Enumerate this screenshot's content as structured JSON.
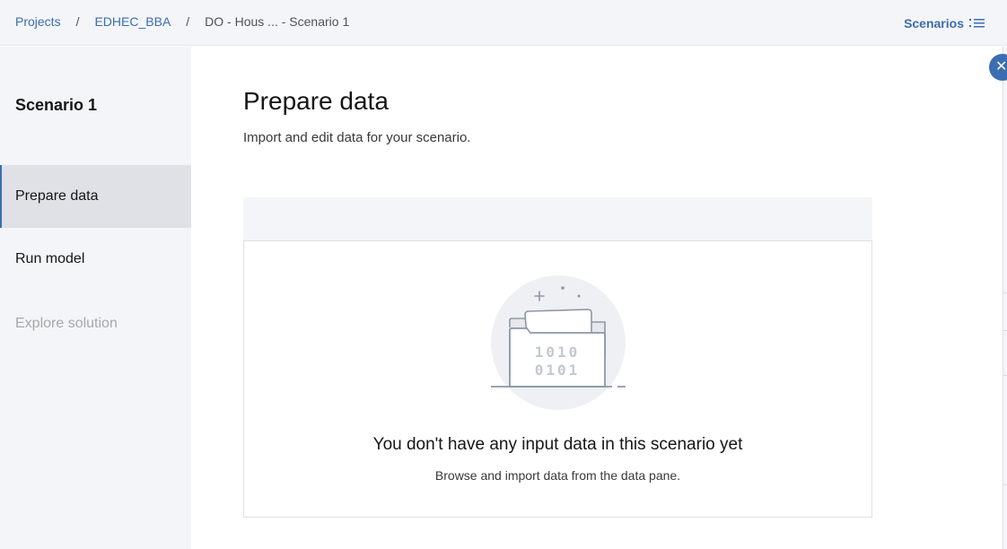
{
  "breadcrumb": {
    "items": [
      "Projects",
      "EDHEC_BBA"
    ],
    "separator": "/",
    "current": "DO - Hous ... - Scenario 1"
  },
  "header": {
    "scenarios_label": "Scenarios",
    "scenarios_icon": "list-icon"
  },
  "sidebar": {
    "title": "Scenario 1",
    "items": [
      {
        "label": "Prepare data",
        "state": "active"
      },
      {
        "label": "Run model",
        "state": "enabled"
      },
      {
        "label": "Explore solution",
        "state": "disabled"
      }
    ]
  },
  "main": {
    "title": "Prepare data",
    "subtitle": "Import and edit data for your scenario."
  },
  "empty_state": {
    "illustration_icon": "folder-binary-icon",
    "illustration_text": [
      "1010",
      "0101"
    ],
    "title": "You don't have any input data in this scenario yet",
    "subtitle": "Browse and import data from the data pane."
  },
  "close_icon": "close-icon",
  "colors": {
    "accent": "#3b6db1",
    "sidebar_bg": "#f4f5f8",
    "active_bg": "#dfe1e6",
    "disabled_text": "#a8a8a8"
  }
}
